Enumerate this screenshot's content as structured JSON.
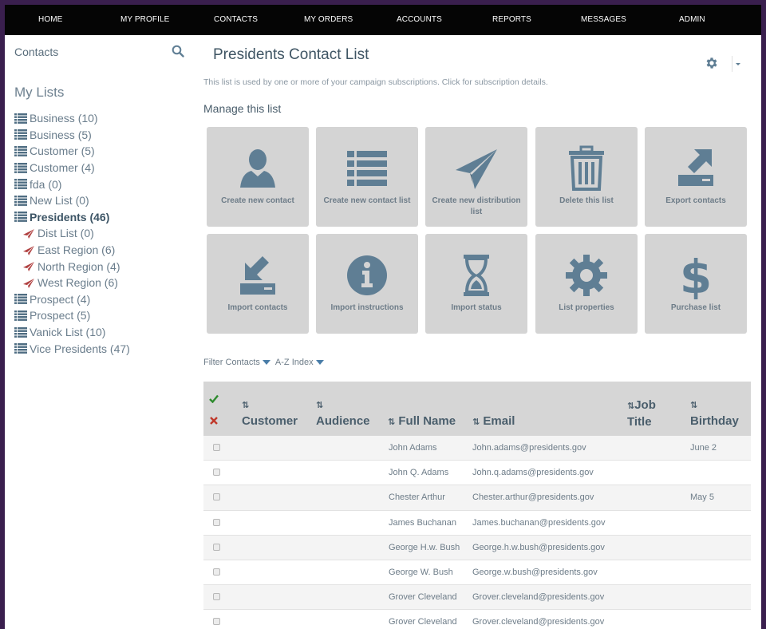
{
  "topnav": {
    "items": [
      "HOME",
      "MY PROFILE",
      "CONTACTS",
      "MY ORDERS",
      "ACCOUNTS",
      "REPORTS",
      "MESSAGES",
      "ADMIN"
    ]
  },
  "sidebar": {
    "header": "Contacts",
    "my_lists_title": "My Lists",
    "items": [
      {
        "label": "Business (10)",
        "type": "list"
      },
      {
        "label": "Business (5)",
        "type": "list"
      },
      {
        "label": "Customer (5)",
        "type": "list"
      },
      {
        "label": "Customer (4)",
        "type": "list"
      },
      {
        "label": "fda (0)",
        "type": "list"
      },
      {
        "label": "New List (0)",
        "type": "list"
      },
      {
        "label": "Presidents (46)",
        "type": "list",
        "active": true
      },
      {
        "label": "Dist List (0)",
        "type": "dist"
      },
      {
        "label": "East Region (6)",
        "type": "dist"
      },
      {
        "label": "North Region (4)",
        "type": "dist"
      },
      {
        "label": "West Region (6)",
        "type": "dist"
      },
      {
        "label": "Prospect (4)",
        "type": "list"
      },
      {
        "label": "Prospect (5)",
        "type": "list"
      },
      {
        "label": "Vanick List (10)",
        "type": "list"
      },
      {
        "label": "Vice Presidents (47)",
        "type": "list"
      }
    ]
  },
  "main": {
    "title": "Presidents Contact List",
    "subtitle": "This list is used by one or more of your campaign subscriptions. Click for subscription details.",
    "manage_title": "Manage this list",
    "tiles": [
      {
        "label": "Create new contact",
        "icon": "person-icon"
      },
      {
        "label": "Create new contact list",
        "icon": "list-icon"
      },
      {
        "label": "Create new distribution list",
        "icon": "paper-plane-icon"
      },
      {
        "label": "Delete this list",
        "icon": "trash-icon"
      },
      {
        "label": "Export contacts",
        "icon": "export-icon"
      },
      {
        "label": "Import contacts",
        "icon": "import-icon"
      },
      {
        "label": "Import instructions",
        "icon": "info-icon"
      },
      {
        "label": "Import status",
        "icon": "hourglass-icon"
      },
      {
        "label": "List properties",
        "icon": "gear-icon"
      },
      {
        "label": "Purchase list",
        "icon": "dollar-icon"
      }
    ],
    "filter_label": "Filter Contacts",
    "az_label": "A-Z Index"
  },
  "table": {
    "columns": {
      "customer": "Customer",
      "audience": "Audience",
      "full_name": "Full Name",
      "email": "Email",
      "job_title_1": "Job",
      "job_title_2": "Title",
      "birthday": "Birthday"
    },
    "rows": [
      {
        "name": "John Adams",
        "email": "John.adams@presidents.gov",
        "birthday": "June 2"
      },
      {
        "name": "John Q. Adams",
        "email": "John.q.adams@presidents.gov",
        "birthday": ""
      },
      {
        "name": "Chester Arthur",
        "email": "Chester.arthur@presidents.gov",
        "birthday": "May 5"
      },
      {
        "name": "James Buchanan",
        "email": "James.buchanan@presidents.gov",
        "birthday": ""
      },
      {
        "name": "George H.w. Bush",
        "email": "George.h.w.bush@presidents.gov",
        "birthday": ""
      },
      {
        "name": "George W. Bush",
        "email": "George.w.bush@presidents.gov",
        "birthday": ""
      },
      {
        "name": "Grover Cleveland",
        "email": "Grover.cleveland@presidents.gov",
        "birthday": ""
      },
      {
        "name": "Grover Cleveland",
        "email": "Grover.cleveland@presidents.gov",
        "birthday": ""
      }
    ]
  },
  "colors": {
    "nav_bg": "#050505",
    "tile_bg": "#d4d4d4",
    "icon_fill": "#5f7e94",
    "dist_icon": "#b04040",
    "check_green": "#2e8b2e",
    "x_red": "#c0392b"
  }
}
